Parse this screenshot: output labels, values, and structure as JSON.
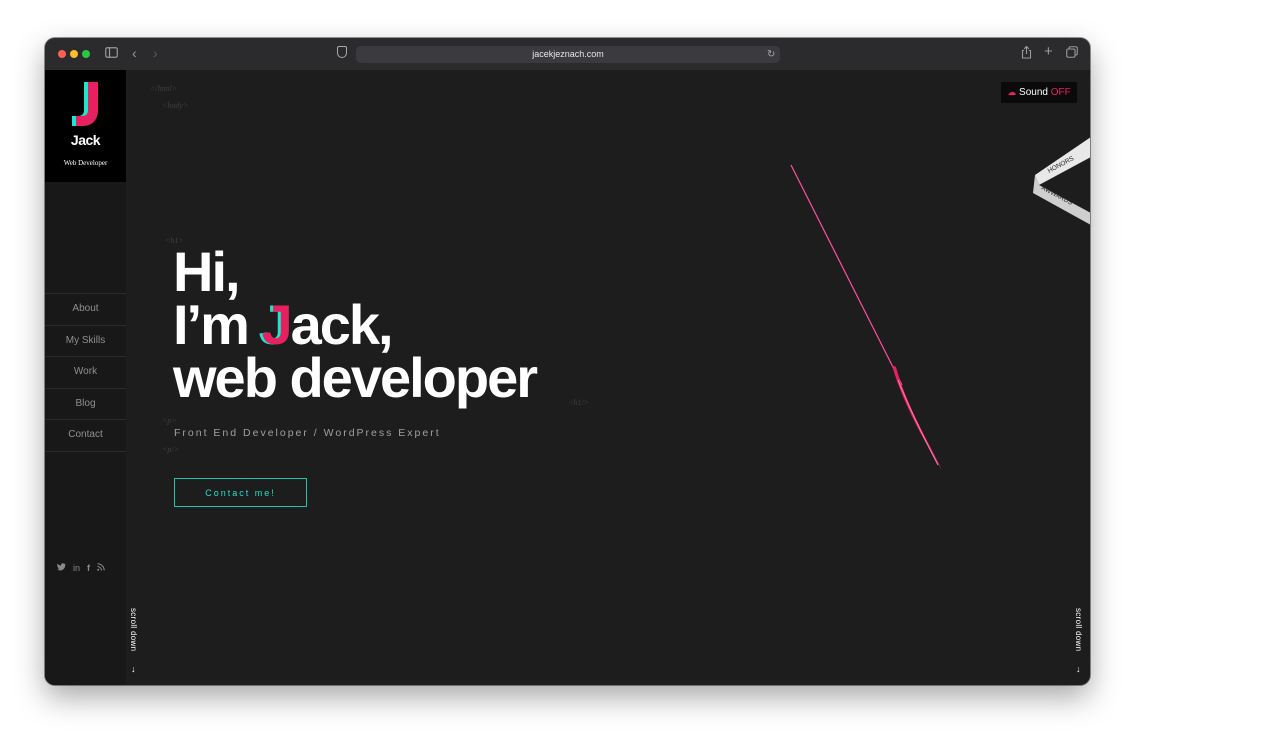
{
  "browser": {
    "url": "jacekjeznach.com"
  },
  "sidebar": {
    "logo_name": "Jack",
    "logo_subtitle": "Web Developer",
    "nav": [
      {
        "label": "About"
      },
      {
        "label": "My Skills"
      },
      {
        "label": "Work"
      },
      {
        "label": "Blog"
      },
      {
        "label": "Contact"
      }
    ],
    "social_icons": [
      "twitter-icon",
      "linkedin-icon",
      "facebook-icon",
      "rss-icon"
    ]
  },
  "code_tags": {
    "html_close": "</html>",
    "body_open": "<body>",
    "h1_open": "<h1>",
    "h1_close": "<h1/>",
    "p_open": "<p>",
    "p_close": "<p/>"
  },
  "hero": {
    "line1": "Hi,",
    "line2_prefix": "I’m ",
    "line2_letter": "J",
    "line2_suffix": "ack,",
    "line3": "web developer",
    "subtitle": "Front End Developer / WordPress Expert",
    "cta_label": "Contact me!"
  },
  "sound": {
    "label": "Sound",
    "state": "OFF"
  },
  "badge": {
    "line1": "HONORS",
    "line2": "AWWARDS"
  },
  "scroll": {
    "label": "scroll down",
    "arrow": "↓"
  },
  "colors": {
    "accent_pink": "#e5225f",
    "accent_teal": "#21e4d0",
    "background": "#1d1d1d"
  }
}
